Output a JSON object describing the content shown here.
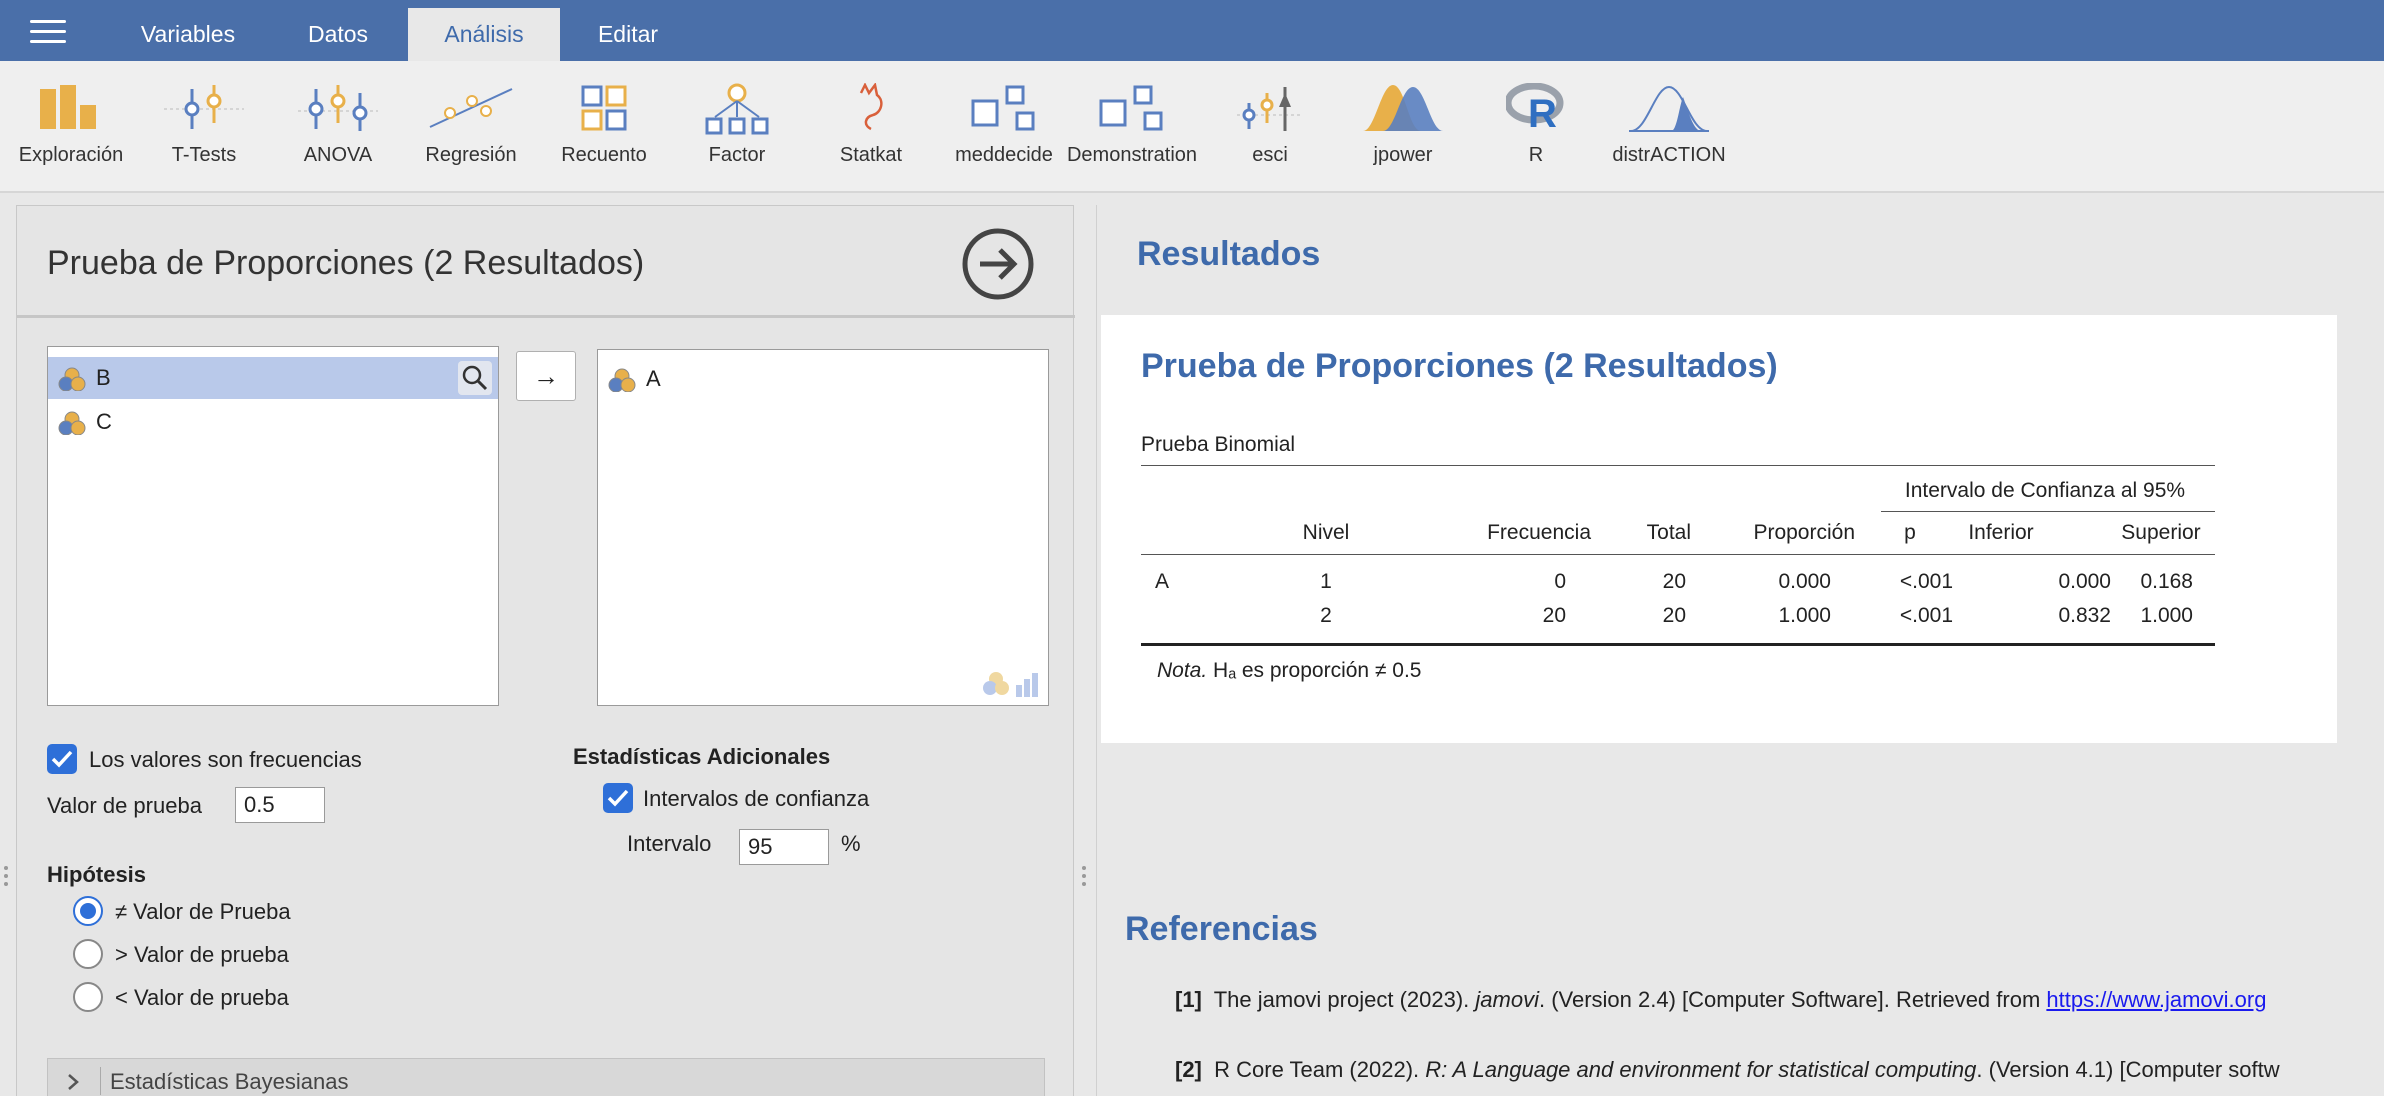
{
  "menu": {
    "tabs": [
      "Variables",
      "Datos",
      "Análisis",
      "Editar"
    ],
    "active_tab": "Análisis"
  },
  "ribbon": {
    "tools": [
      {
        "label": "Exploración",
        "icon": "exploration-icon"
      },
      {
        "label": "T-Tests",
        "icon": "ttests-icon"
      },
      {
        "label": "ANOVA",
        "icon": "anova-icon"
      },
      {
        "label": "Regresión",
        "icon": "regression-icon"
      },
      {
        "label": "Recuento",
        "icon": "frequencies-icon"
      },
      {
        "label": "Factor",
        "icon": "factor-icon"
      },
      {
        "label": "Statkat",
        "icon": "statkat-icon"
      },
      {
        "label": "meddecide",
        "icon": "meddecide-icon"
      },
      {
        "label": "Demonstration",
        "icon": "demonstration-icon"
      },
      {
        "label": "esci",
        "icon": "esci-icon"
      },
      {
        "label": "jpower",
        "icon": "jpower-icon"
      },
      {
        "label": "R",
        "icon": "r-logo-icon"
      },
      {
        "label": "distrACTION",
        "icon": "distraction-icon"
      }
    ]
  },
  "options": {
    "title": "Prueba de Proporciones (2 Resultados)",
    "source_vars": [
      "B",
      "C"
    ],
    "target_vars": [
      "A"
    ],
    "move_arrow": "→",
    "frequencies_label": "Los valores son frecuencias",
    "test_value_label": "Valor de prueba",
    "test_value": "0.5",
    "hypothesis_heading": "Hipótesis",
    "hypotheses": [
      "≠ Valor de Prueba",
      "> Valor de prueba",
      "< Valor de prueba"
    ],
    "additional_heading": "Estadísticas Adicionales",
    "ci_label": "Intervalos de confianza",
    "interval_label": "Intervalo",
    "interval_value": "95",
    "percent": "%",
    "bayes_label": "Estadísticas Bayesianas"
  },
  "results": {
    "heading": "Resultados",
    "analysis_title": "Prueba de Proporciones (2 Resultados)",
    "table_title": "Prueba Binomial",
    "ci_header": "Intervalo de Confianza al 95%",
    "columns": [
      "Nivel",
      "Frecuencia",
      "Total",
      "Proporción",
      "p",
      "Inferior",
      "Superior"
    ],
    "var_name": "A",
    "rows": [
      [
        "1",
        "0",
        "20",
        "0.000",
        "<.001",
        "0.000",
        "0.168"
      ],
      [
        "2",
        "20",
        "20",
        "1.000",
        "<.001",
        "0.832",
        "1.000"
      ]
    ],
    "note_prefix": "Nota.",
    "note_text": "Hₐ es proporción ≠ 0.5"
  },
  "references": {
    "heading": "Referencias",
    "items": [
      {
        "num": "[1]",
        "pre": "The jamovi project (2023). ",
        "italic": "jamovi",
        "post": ". (Version 2.4) [Computer Software]. Retrieved from ",
        "link": "https://www.jamovi.org"
      },
      {
        "num": "[2]",
        "pre": "R Core Team (2022). ",
        "italic": "R: A Language and environment for statistical computing",
        "post": ". (Version 4.1) [Computer softw",
        "link": ""
      }
    ]
  }
}
